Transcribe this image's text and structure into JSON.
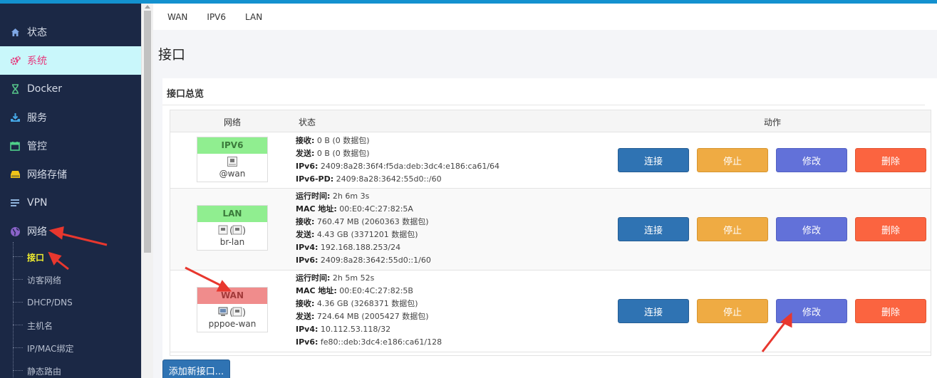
{
  "sidebar": {
    "items": [
      {
        "label": "状态",
        "icon": "home-icon"
      },
      {
        "label": "系统",
        "icon": "gears-icon"
      },
      {
        "label": "Docker",
        "icon": "hourglass-icon"
      },
      {
        "label": "服务",
        "icon": "download-tray-icon"
      },
      {
        "label": "管控",
        "icon": "calendar-icon"
      },
      {
        "label": "网络存储",
        "icon": "hdd-icon"
      },
      {
        "label": "VPN",
        "icon": "list-icon"
      },
      {
        "label": "网络",
        "icon": "globe-icon"
      }
    ],
    "subitems": [
      "接口",
      "访客网络",
      "DHCP/DNS",
      "主机名",
      "IP/MAC绑定",
      "静态路由"
    ]
  },
  "tabs": [
    "WAN",
    "IPV6",
    "LAN"
  ],
  "page_title": "接口",
  "section_title": "接口总览",
  "table": {
    "headers": {
      "network": "网络",
      "status": "状态",
      "actions": "动作"
    },
    "rows": [
      {
        "name": "IPV6",
        "name_color": "#90ee90",
        "icons": "🖧",
        "device": "@wan",
        "status": [
          {
            "k": "接收:",
            "v": " 0 B (0 数据包)"
          },
          {
            "k": "发送:",
            "v": " 0 B (0 数据包)"
          },
          {
            "k": "IPv6:",
            "v": " 2409:8a28:36f4:f5da:deb:3dc4:e186:ca61/64"
          },
          {
            "k": "IPv6-PD:",
            "v": " 2409:8a28:3642:55d0::/60"
          }
        ]
      },
      {
        "name": "LAN",
        "name_color": "#90ee90",
        "icons": "🖧 (🖧)",
        "device": "br-lan",
        "status": [
          {
            "k": "运行时间:",
            "v": " 2h 6m 3s"
          },
          {
            "k": "MAC 地址:",
            "v": " 00:E0:4C:27:82:5A"
          },
          {
            "k": "接收:",
            "v": " 760.47 MB (2060363 数据包)"
          },
          {
            "k": "发送:",
            "v": " 4.43 GB (3371201 数据包)"
          },
          {
            "k": "IPv4:",
            "v": " 192.168.188.253/24"
          },
          {
            "k": "IPv6:",
            "v": " 2409:8a28:3642:55d0::1/60"
          }
        ]
      },
      {
        "name": "WAN",
        "name_color": "#f08c8c",
        "icons": "🖥 (🖧)",
        "device": "pppoe-wan",
        "status": [
          {
            "k": "运行时间:",
            "v": " 2h 5m 52s"
          },
          {
            "k": "MAC 地址:",
            "v": " 00:E0:4C:27:82:5B"
          },
          {
            "k": "接收:",
            "v": " 4.36 GB (3268371 数据包)"
          },
          {
            "k": "发送:",
            "v": " 724.64 MB (2005427 数据包)"
          },
          {
            "k": "IPv4:",
            "v": " 10.112.53.118/32"
          },
          {
            "k": "IPv6:",
            "v": " fe80::deb:3dc4:e186:ca61/128"
          }
        ]
      }
    ],
    "buttons": {
      "connect": "连接",
      "stop": "停止",
      "edit": "修改",
      "delete": "删除"
    }
  },
  "add_button": "添加新接口..."
}
